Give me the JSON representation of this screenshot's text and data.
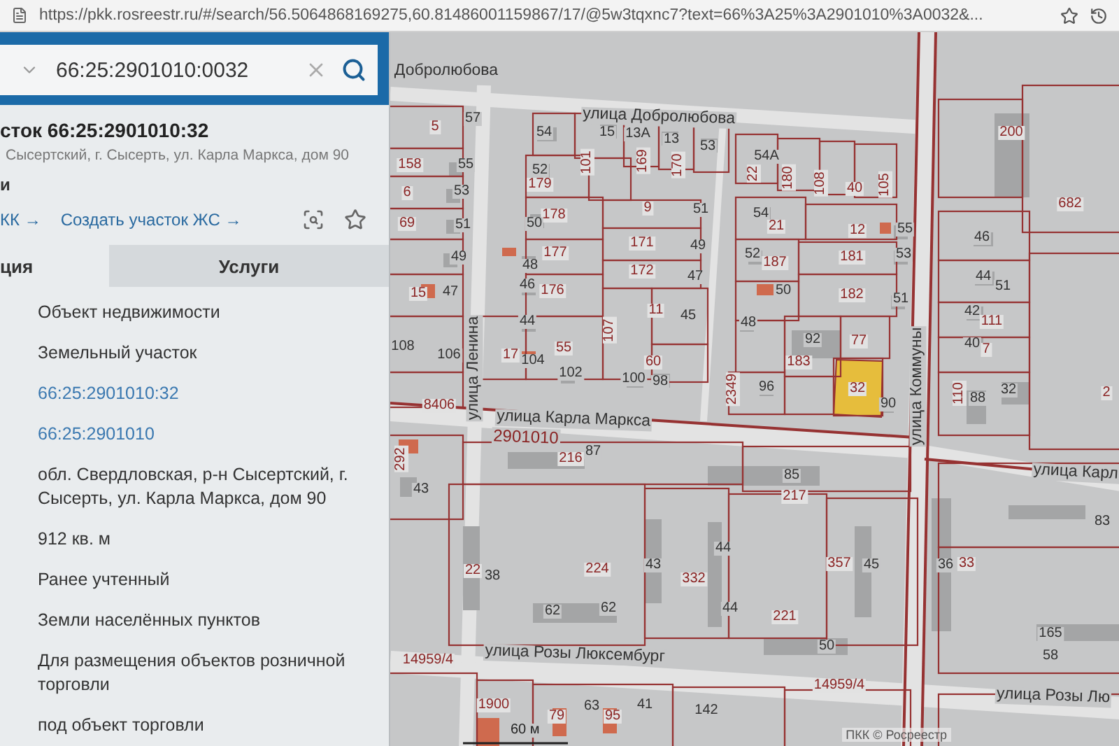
{
  "browser": {
    "url": "https://pkk.rosreestr.ru/#/search/56.5064868169275,60.81486001159867/17/@5w3tqxnc7?text=66%3A25%3A2901010%3A0032&..."
  },
  "search": {
    "value": "66:25:2901010:0032"
  },
  "panel": {
    "title": "сток 66:25:2901010:32",
    "address": "Сысертский, г. Сысерть, ул. Карла Маркса, дом 90",
    "subtitle": "и",
    "links": [
      "КК →",
      "Создать участок ЖС →"
    ],
    "tabs": [
      {
        "label": "ция",
        "selected": true
      },
      {
        "label": "Услуги",
        "selected": false
      }
    ],
    "fields": [
      {
        "value": "Объект недвижимости",
        "kind": "text"
      },
      {
        "value": "Земельный участок",
        "kind": "text"
      },
      {
        "value": "66:25:2901010:32",
        "kind": "link"
      },
      {
        "value": "66:25:2901010",
        "kind": "link"
      },
      {
        "value": "обл. Свердловская, р-н Сысертский, г. Сысерть, ул. Карла Маркса, дом 90",
        "kind": "text"
      },
      {
        "value": "912 кв. м",
        "kind": "text"
      },
      {
        "value": "Ранее учтенный",
        "kind": "text"
      },
      {
        "value": "Земли населённых пунктов",
        "kind": "text"
      },
      {
        "value": "Для размещения объектов розничной торговли",
        "kind": "text"
      },
      {
        "value": "под объект торговли",
        "kind": "text"
      }
    ]
  },
  "map": {
    "labels": [
      {
        "text": "Добролюбова",
        "kind": "street"
      },
      {
        "text": "улица Добролюбова",
        "kind": "street"
      },
      {
        "text": "5",
        "kind": "parcel"
      },
      {
        "text": "57",
        "kind": "building"
      },
      {
        "text": "54",
        "kind": "building"
      },
      {
        "text": "15",
        "kind": "building"
      },
      {
        "text": "13А",
        "kind": "building"
      },
      {
        "text": "13",
        "kind": "building"
      },
      {
        "text": "200",
        "kind": "parcel"
      },
      {
        "text": "53",
        "kind": "building"
      },
      {
        "text": "54А",
        "kind": "building"
      },
      {
        "text": "158",
        "kind": "parcel"
      },
      {
        "text": "55",
        "kind": "building"
      },
      {
        "text": "52",
        "kind": "building"
      },
      {
        "text": "101",
        "kind": "parcel"
      },
      {
        "text": "169",
        "kind": "parcel"
      },
      {
        "text": "170",
        "kind": "parcel"
      },
      {
        "text": "22",
        "kind": "parcel"
      },
      {
        "text": "6",
        "kind": "parcel"
      },
      {
        "text": "53",
        "kind": "building"
      },
      {
        "text": "179",
        "kind": "parcel"
      },
      {
        "text": "180",
        "kind": "parcel"
      },
      {
        "text": "108",
        "kind": "parcel"
      },
      {
        "text": "40",
        "kind": "parcel"
      },
      {
        "text": "105",
        "kind": "parcel"
      },
      {
        "text": "178",
        "kind": "parcel"
      },
      {
        "text": "9",
        "kind": "parcel"
      },
      {
        "text": "51",
        "kind": "building"
      },
      {
        "text": "54",
        "kind": "building"
      },
      {
        "text": "682",
        "kind": "parcel"
      },
      {
        "text": "69",
        "kind": "parcel"
      },
      {
        "text": "51",
        "kind": "building"
      },
      {
        "text": "50",
        "kind": "building"
      },
      {
        "text": "21",
        "kind": "parcel"
      },
      {
        "text": "12",
        "kind": "parcel"
      },
      {
        "text": "55",
        "kind": "building"
      },
      {
        "text": "171",
        "kind": "parcel"
      },
      {
        "text": "49",
        "kind": "building"
      },
      {
        "text": "46",
        "kind": "building"
      },
      {
        "text": "49",
        "kind": "building"
      },
      {
        "text": "48",
        "kind": "building"
      },
      {
        "text": "177",
        "kind": "parcel"
      },
      {
        "text": "52",
        "kind": "building"
      },
      {
        "text": "187",
        "kind": "parcel"
      },
      {
        "text": "181",
        "kind": "parcel"
      },
      {
        "text": "53",
        "kind": "building"
      },
      {
        "text": "172",
        "kind": "parcel"
      },
      {
        "text": "47",
        "kind": "building"
      },
      {
        "text": "44",
        "kind": "building"
      },
      {
        "text": "15",
        "kind": "parcel"
      },
      {
        "text": "47",
        "kind": "building"
      },
      {
        "text": "46",
        "kind": "building"
      },
      {
        "text": "176",
        "kind": "parcel"
      },
      {
        "text": "50",
        "kind": "building"
      },
      {
        "text": "182",
        "kind": "parcel"
      },
      {
        "text": "51",
        "kind": "building"
      },
      {
        "text": "51",
        "kind": "building"
      },
      {
        "text": "44",
        "kind": "building"
      },
      {
        "text": "11",
        "kind": "parcel"
      },
      {
        "text": "45",
        "kind": "building"
      },
      {
        "text": "48",
        "kind": "building"
      },
      {
        "text": "42",
        "kind": "building"
      },
      {
        "text": "111",
        "kind": "parcel"
      },
      {
        "text": "108",
        "kind": "building"
      },
      {
        "text": "55",
        "kind": "parcel"
      },
      {
        "text": "107",
        "kind": "parcel"
      },
      {
        "text": "92",
        "kind": "building"
      },
      {
        "text": "77",
        "kind": "parcel"
      },
      {
        "text": "40",
        "kind": "building"
      },
      {
        "text": "7",
        "kind": "parcel"
      },
      {
        "text": "106",
        "kind": "building"
      },
      {
        "text": "улица Ленина",
        "kind": "street"
      },
      {
        "text": "17",
        "kind": "parcel"
      },
      {
        "text": "104",
        "kind": "building"
      },
      {
        "text": "60",
        "kind": "parcel"
      },
      {
        "text": "183",
        "kind": "parcel"
      },
      {
        "text": "102",
        "kind": "building"
      },
      {
        "text": "100",
        "kind": "building"
      },
      {
        "text": "98",
        "kind": "building"
      },
      {
        "text": "2349",
        "kind": "parcel"
      },
      {
        "text": "96",
        "kind": "building"
      },
      {
        "text": "32",
        "kind": "parcel"
      },
      {
        "text": "улица Коммуны",
        "kind": "street"
      },
      {
        "text": "110",
        "kind": "parcel"
      },
      {
        "text": "88",
        "kind": "building"
      },
      {
        "text": "32",
        "kind": "building"
      },
      {
        "text": "2",
        "kind": "parcel"
      },
      {
        "text": "8406",
        "kind": "parcel"
      },
      {
        "text": "90",
        "kind": "building"
      },
      {
        "text": "улица Карла Маркса",
        "kind": "street"
      },
      {
        "text": "2901010",
        "kind": "block"
      },
      {
        "text": "292",
        "kind": "parcel"
      },
      {
        "text": "216",
        "kind": "parcel"
      },
      {
        "text": "87",
        "kind": "building"
      },
      {
        "text": "85",
        "kind": "building"
      },
      {
        "text": "улица Карл",
        "kind": "street"
      },
      {
        "text": "43",
        "kind": "building"
      },
      {
        "text": "217",
        "kind": "parcel"
      },
      {
        "text": "83",
        "kind": "building"
      },
      {
        "text": "44",
        "kind": "building"
      },
      {
        "text": "22",
        "kind": "parcel"
      },
      {
        "text": "38",
        "kind": "building"
      },
      {
        "text": "224",
        "kind": "parcel"
      },
      {
        "text": "43",
        "kind": "building"
      },
      {
        "text": "332",
        "kind": "parcel"
      },
      {
        "text": "357",
        "kind": "parcel"
      },
      {
        "text": "45",
        "kind": "building"
      },
      {
        "text": "36",
        "kind": "building"
      },
      {
        "text": "33",
        "kind": "parcel"
      },
      {
        "text": "62",
        "kind": "building"
      },
      {
        "text": "62",
        "kind": "building"
      },
      {
        "text": "44",
        "kind": "building"
      },
      {
        "text": "221",
        "kind": "parcel"
      },
      {
        "text": "165",
        "kind": "building"
      },
      {
        "text": "50",
        "kind": "building"
      },
      {
        "text": "14959/4",
        "kind": "parcel"
      },
      {
        "text": "улица Розы Люксембург",
        "kind": "street"
      },
      {
        "text": "58",
        "kind": "building"
      },
      {
        "text": "14959/4",
        "kind": "parcel"
      },
      {
        "text": "улица Розы Лю",
        "kind": "street"
      },
      {
        "text": "1900",
        "kind": "parcel"
      },
      {
        "text": "79",
        "kind": "parcel"
      },
      {
        "text": "63",
        "kind": "building"
      },
      {
        "text": "95",
        "kind": "parcel"
      },
      {
        "text": "41",
        "kind": "building"
      },
      {
        "text": "142",
        "kind": "building"
      }
    ],
    "scale": "60 м",
    "attribution": "ПКК © Росреестр"
  }
}
